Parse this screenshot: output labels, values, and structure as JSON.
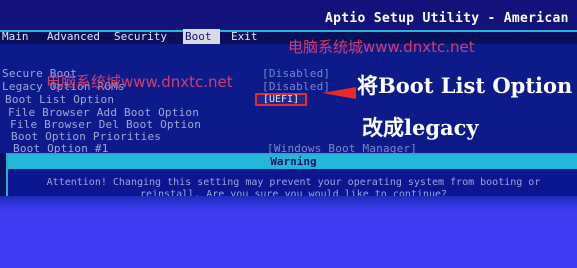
{
  "header": {
    "title": "Aptio Setup Utility - American Meg"
  },
  "tabs": [
    {
      "label": "Main"
    },
    {
      "label": "Advanced"
    },
    {
      "label": "Security"
    },
    {
      "label": "Boot",
      "active": true
    },
    {
      "label": "Exit"
    }
  ],
  "settings": [
    {
      "label": "Secure Boot",
      "value": "[Disabled]"
    },
    {
      "label": "Legacy Option ROMs",
      "value": "[Disabled]"
    },
    {
      "label": "Boot List Option",
      "value": "[UEFI]",
      "selected": true
    },
    {
      "label": "File Browser Add Boot Option",
      "value": ""
    },
    {
      "label": "File Browser Del Boot Option",
      "value": ""
    },
    {
      "label": "Boot Option Priorities",
      "value": ""
    },
    {
      "label": "Boot Option #1",
      "value": "[Windows Boot Manager]"
    }
  ],
  "annotation": {
    "line1": "将Boot List Option",
    "line2": "改成legacy",
    "arrow_color": "#e72a2a"
  },
  "watermarks": [
    "电脑系统城www.dnxtc.net",
    "电脑系统城www.dnxtc.net"
  ],
  "dialog": {
    "title": "Warning",
    "message_line1": "Attention! Changing this setting may prevent your operating system from booting or",
    "message_line2": "reinstall. Are you sure you would like to continue?"
  },
  "colors": {
    "background": "#0d1b8a",
    "header": "#13127a",
    "accent": "#27b6d6",
    "highlight_border": "#e72a2a",
    "watermark": "#e6416a"
  }
}
